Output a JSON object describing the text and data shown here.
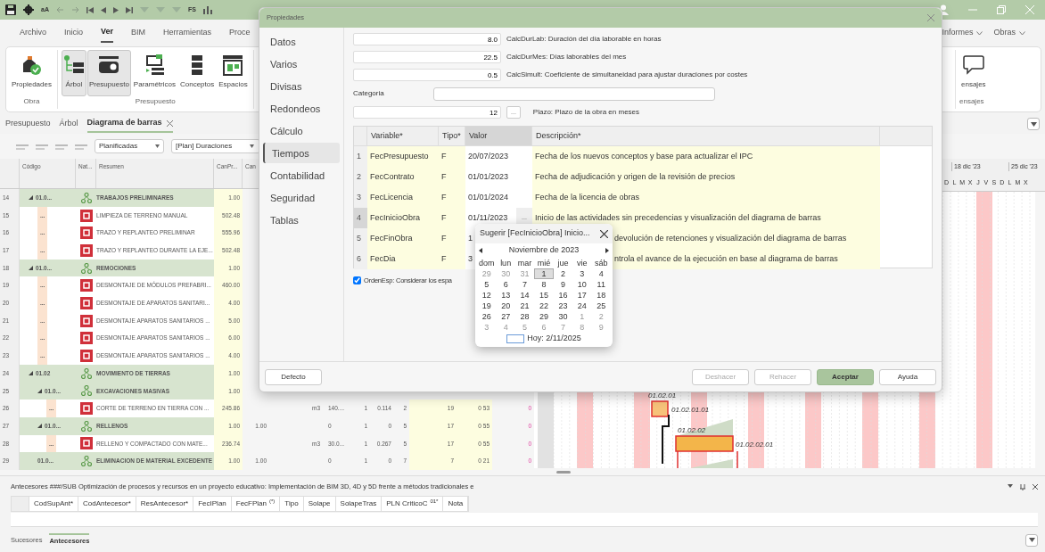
{
  "titlebar": {
    "text_buttons": [
      "aA",
      "FS"
    ]
  },
  "ribbon_tabs": [
    {
      "label": "Archivo",
      "selected": false
    },
    {
      "label": "Inicio",
      "selected": false
    },
    {
      "label": "Ver",
      "selected": true
    },
    {
      "label": "BIM",
      "selected": false
    },
    {
      "label": "Herramientas",
      "selected": false
    },
    {
      "label": "Proce",
      "selected": false
    }
  ],
  "ribbon_menus": [
    "Informes",
    "Obras"
  ],
  "ribbon_groups": [
    {
      "label": "Obra",
      "buttons": [
        {
          "label": "Propiedades",
          "kind": "properties",
          "selected": false
        }
      ]
    },
    {
      "label": "Presupuesto",
      "buttons": [
        {
          "label": "Árbol",
          "kind": "tree",
          "selected": true
        },
        {
          "label": "Presupuesto",
          "kind": "budget",
          "selected": true
        },
        {
          "label": "Paramétricos",
          "kind": "parametric",
          "selected": false
        },
        {
          "label": "Conceptos",
          "kind": "concepts",
          "selected": false
        },
        {
          "label": "Espacios",
          "kind": "spaces",
          "selected": false
        }
      ]
    },
    {
      "label": "ensajes",
      "buttons": [
        {
          "label": "ensajes",
          "kind": "message",
          "selected": false
        }
      ]
    }
  ],
  "doc_tabs": [
    {
      "label": "Presupuesto",
      "selected": false,
      "closable": false
    },
    {
      "label": "Árbol",
      "selected": false,
      "closable": false
    },
    {
      "label": "Diagrama de barras",
      "selected": true,
      "closable": true
    }
  ],
  "planning_selects": [
    "Planificadas",
    "[Plan] Duraciones"
  ],
  "table": {
    "columns": [
      "Código",
      "Nat...",
      "Resumen",
      "CanPr...",
      "Can"
    ],
    "rows": [
      {
        "num": "14",
        "code": "01.0...",
        "kind": "chapter",
        "summary": "TRABAJOS PRELIMINARES",
        "qty": "1.00",
        "children": [
          {
            "num": "15",
            "code": "...",
            "kind": "item",
            "summary": "LIMPIEZA DE TERRENO MANUAL",
            "qty": "502.48"
          },
          {
            "num": "16",
            "code": "...",
            "kind": "item",
            "summary": "TRAZO Y REPLANTEO PRELIMINAR",
            "qty": "555.96"
          },
          {
            "num": "17",
            "code": "...",
            "kind": "item",
            "summary": "TRAZO Y REPLANTEO DURANTE LA EJE...",
            "qty": "502.48"
          }
        ]
      },
      {
        "num": "18",
        "code": "01.0...",
        "kind": "chapter",
        "summary": "REMOCIONES",
        "qty": "1.00",
        "children": [
          {
            "num": "19",
            "code": "...",
            "kind": "item",
            "summary": "DESMONTAJE DE MÓDULOS PREFABRI...",
            "qty": "460.00"
          },
          {
            "num": "20",
            "code": "...",
            "kind": "item",
            "summary": "DESMONTAJE DE APARATOS SANITARI...",
            "qty": "4.00"
          },
          {
            "num": "21",
            "code": "...",
            "kind": "item",
            "summary": "DESMONTAJE APARATOS SANITARIOS ...",
            "qty": "5.00"
          },
          {
            "num": "22",
            "code": "...",
            "kind": "item",
            "summary": "DESMONTAJE APARATOS SANITARIOS ...",
            "qty": "6.00"
          },
          {
            "num": "23",
            "code": "...",
            "kind": "item",
            "summary": "DESMONTAJE APARATOS SANITARIOS ...",
            "qty": "4.00"
          }
        ]
      },
      {
        "num": "24",
        "code": "01.02",
        "kind": "chapter",
        "summary": "MOVIMIENTO DE TIERRAS",
        "qty": "1.00",
        "children": [
          {
            "num": "25",
            "code": "01.0...",
            "kind": "chapter",
            "summary": "EXCAVACIONES MASIVAS",
            "qty": "1.00",
            "children": [
              {
                "num": "26",
                "code": "...",
                "kind": "item",
                "summary": "CORTE DE TERRENO EN TIERRA CON ...",
                "qty": "245.86",
                "cells": [
                  null,
                  "m3",
                  "140....",
                  "1",
                  "0.114",
                  "2",
                  "19",
                  "0 53",
                  "0"
                ]
              }
            ]
          },
          {
            "num": "27",
            "code": "01.0...",
            "kind": "chapter",
            "summary": "RELLENOS",
            "qty": "1.00",
            "cells": [
              "1.00",
              null,
              "0",
              "1",
              "0",
              "5",
              "17",
              "0 55",
              "0"
            ],
            "children": [
              {
                "num": "28",
                "code": "...",
                "kind": "item",
                "summary": "RELLENO Y COMPACTADO CON MATE...",
                "qty": "236.74",
                "cells": [
                  null,
                  "m3",
                  "30.0...",
                  "1",
                  "0.267",
                  "5",
                  "17",
                  "0 55",
                  "0"
                ]
              }
            ]
          },
          {
            "num": "29",
            "code": "01.0...",
            "kind": "chapter",
            "summary": "ELIMINACION DE MATERIAL EXCEDENTE",
            "qty": "1.00",
            "cells": [
              "1.00",
              null,
              "0",
              "1",
              "0",
              "7",
              "7",
              "0 21",
              "0"
            ]
          }
        ]
      }
    ]
  },
  "gantt": {
    "weeks": [
      "18 dic '23",
      "25 dic '23"
    ],
    "days": [
      "D",
      "L",
      "M",
      "X",
      "J",
      "V",
      "S",
      "D",
      "L",
      "M",
      "X"
    ],
    "labels": [
      "01.02.01",
      "01.02.01.01",
      "01.02.02",
      "01.02.02.01"
    ]
  },
  "dialog": {
    "title": "Propiedades",
    "nav": [
      {
        "label": "Datos",
        "selected": false
      },
      {
        "label": "Varios",
        "selected": false
      },
      {
        "label": "Divisas",
        "selected": false
      },
      {
        "label": "Redondeos",
        "selected": false
      },
      {
        "label": "Cálculo",
        "selected": false
      },
      {
        "label": "Tiempos",
        "selected": true
      },
      {
        "label": "Contabilidad",
        "selected": false
      },
      {
        "label": "Seguridad",
        "selected": false
      },
      {
        "label": "Tablas",
        "selected": false
      }
    ],
    "params": [
      {
        "value": "8.0",
        "label": "CalcDurLab: Duración del día laborable en horas"
      },
      {
        "value": "22.5",
        "label": "CalcDurMes: Días laborables del mes"
      },
      {
        "value": "0.5",
        "label": "CalcSimult: Coeficiente de simultaneidad para ajustar duraciones por costes"
      }
    ],
    "category_label": "Categoria",
    "plazo": {
      "value": "12",
      "button": "...",
      "label": "Plazo: Plazo de la obra en meses"
    },
    "columns": [
      {
        "label": "Variable*",
        "selected": false
      },
      {
        "label": "Tipo*",
        "selected": false
      },
      {
        "label": "Valor",
        "selected": true
      },
      {
        "label": "Descripción*",
        "selected": false
      }
    ],
    "rows": [
      {
        "num": "1",
        "variable": "FecPresupuesto",
        "tipo": "F",
        "valor": "20/07/2023",
        "descripcion": "Fecha de los nuevos conceptos y base para actualizar el IPC",
        "current": false,
        "partly_hidden": false
      },
      {
        "num": "2",
        "variable": "FecContrato",
        "tipo": "F",
        "valor": "01/01/2023",
        "descripcion": "Fecha de adjudicación y origen de la revisión de precios",
        "current": false,
        "partly_hidden": false
      },
      {
        "num": "3",
        "variable": "FecLicencia",
        "tipo": "F",
        "valor": "01/01/2024",
        "descripcion": "Fecha de la licencia de obras",
        "current": false,
        "partly_hidden": false
      },
      {
        "num": "4",
        "variable": "FecInicioObra",
        "tipo": "F",
        "valor": "01/11/2023",
        "button": "...",
        "descripcion": "Inicio de las actividades sin precedencias y visualización del diagrama de barras",
        "current": true,
        "partly_hidden": false
      },
      {
        "num": "5",
        "variable": "FecFinObra",
        "tipo": "F",
        "valor": "1",
        "descripcion": "devolución de retenciones y visualización del diagrama de barras",
        "current": false,
        "partly_hidden": true
      },
      {
        "num": "6",
        "variable": "FecDia",
        "tipo": "F",
        "valor": "3",
        "descripcion": "ntrola el avance de la ejecución en base al diagrama de barras",
        "current": false,
        "partly_hidden": true
      }
    ],
    "checkbox": {
      "label": "OrdenEsp: Considerar los espa",
      "checked": true
    },
    "buttons": [
      {
        "label": "Defecto",
        "kind": "default",
        "disabled": false
      },
      {
        "label": "Deshacer",
        "kind": "default",
        "disabled": true
      },
      {
        "label": "Rehacer",
        "kind": "default",
        "disabled": true
      },
      {
        "label": "Aceptar",
        "kind": "primary",
        "disabled": false
      },
      {
        "label": "Ayuda",
        "kind": "default",
        "disabled": false
      }
    ],
    "popup": {
      "title": "Sugerir [FecInicioObra] Inicio...",
      "month": "Noviembre de 2023",
      "weekdays": [
        "dom",
        "lun",
        "mar",
        "mié",
        "jue",
        "vie",
        "sáb"
      ],
      "weeks": [
        [
          {
            "d": "29",
            "outside": true,
            "selected": false
          },
          {
            "d": "30",
            "outside": true,
            "selected": false
          },
          {
            "d": "31",
            "outside": true,
            "selected": false
          },
          {
            "d": "1",
            "outside": false,
            "selected": true
          },
          {
            "d": "2",
            "outside": false,
            "selected": false
          },
          {
            "d": "3",
            "outside": false,
            "selected": false
          },
          {
            "d": "4",
            "outside": false,
            "selected": false
          }
        ],
        [
          {
            "d": "5",
            "outside": false,
            "selected": false
          },
          {
            "d": "6",
            "outside": false,
            "selected": false
          },
          {
            "d": "7",
            "outside": false,
            "selected": false
          },
          {
            "d": "8",
            "outside": false,
            "selected": false
          },
          {
            "d": "9",
            "outside": false,
            "selected": false
          },
          {
            "d": "10",
            "outside": false,
            "selected": false
          },
          {
            "d": "11",
            "outside": false,
            "selected": false
          }
        ],
        [
          {
            "d": "12",
            "outside": false,
            "selected": false
          },
          {
            "d": "13",
            "outside": false,
            "selected": false
          },
          {
            "d": "14",
            "outside": false,
            "selected": false
          },
          {
            "d": "15",
            "outside": false,
            "selected": false
          },
          {
            "d": "16",
            "outside": false,
            "selected": false
          },
          {
            "d": "17",
            "outside": false,
            "selected": false
          },
          {
            "d": "18",
            "outside": false,
            "selected": false
          }
        ],
        [
          {
            "d": "19",
            "outside": false,
            "selected": false
          },
          {
            "d": "20",
            "outside": false,
            "selected": false
          },
          {
            "d": "21",
            "outside": false,
            "selected": false
          },
          {
            "d": "22",
            "outside": false,
            "selected": false
          },
          {
            "d": "23",
            "outside": false,
            "selected": false
          },
          {
            "d": "24",
            "outside": false,
            "selected": false
          },
          {
            "d": "25",
            "outside": false,
            "selected": false
          }
        ],
        [
          {
            "d": "26",
            "outside": false,
            "selected": false
          },
          {
            "d": "27",
            "outside": false,
            "selected": false
          },
          {
            "d": "28",
            "outside": false,
            "selected": false
          },
          {
            "d": "29",
            "outside": false,
            "selected": false
          },
          {
            "d": "30",
            "outside": false,
            "selected": false
          },
          {
            "d": "1",
            "outside": true,
            "selected": false
          },
          {
            "d": "2",
            "outside": true,
            "selected": false
          }
        ],
        [
          {
            "d": "3",
            "outside": true,
            "selected": false
          },
          {
            "d": "4",
            "outside": true,
            "selected": false
          },
          {
            "d": "5",
            "outside": true,
            "selected": false
          },
          {
            "d": "6",
            "outside": true,
            "selected": false
          },
          {
            "d": "7",
            "outside": true,
            "selected": false
          },
          {
            "d": "8",
            "outside": true,
            "selected": false
          },
          {
            "d": "9",
            "outside": true,
            "selected": false
          }
        ]
      ],
      "today": "Hoy: 2/11/2025"
    }
  },
  "bottom_panel": {
    "title": "Antecesores ###/SUB Optimización de procesos y recursos en un proyecto educativo: Implementación de BIM 3D, 4D y 5D frente a métodos tradicionales e",
    "columns": [
      "CodSupAnt*",
      "CodAntecesor*",
      "ResAntecesor*",
      "FecIPlan",
      "FecFPlan$^{(*)}$",
      "Tipo",
      "Solape",
      "SolapeTras",
      "PLN CriticoC $^{01*}$",
      "Nota"
    ],
    "tabs": [
      {
        "label": "Sucesores",
        "selected": false
      },
      {
        "label": "Antecesores",
        "selected": true
      }
    ]
  }
}
